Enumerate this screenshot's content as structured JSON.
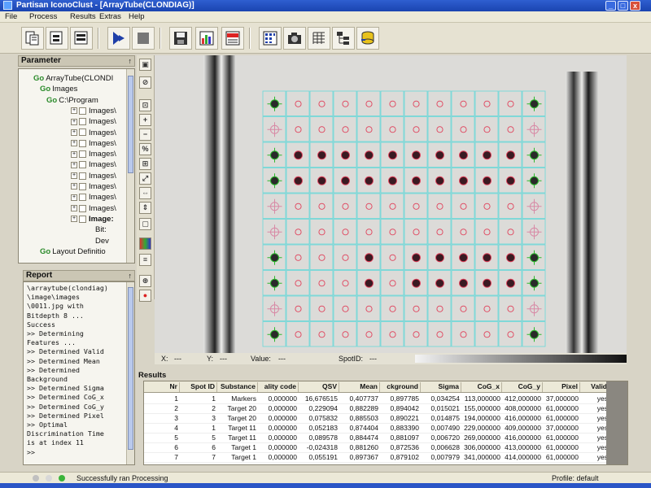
{
  "window": {
    "title": "Partisan IconoClust - [ArrayTube(CLONDIAG)]",
    "colors": {
      "title_bar": "#1a44b0",
      "chrome": "#d8d4c6",
      "grid": "#6ad8d8",
      "marker": "#2db82d",
      "spot": "#e0405a"
    }
  },
  "menu": [
    "File",
    "Process",
    "Results",
    "Extras",
    "Help"
  ],
  "toolbar": {
    "icons": [
      "open-icon",
      "import-icon",
      "export-icon",
      "run-icon",
      "stop-icon",
      "save-icon",
      "chart-icon",
      "pdf-icon",
      "grid-icon",
      "camera-icon",
      "matrix-icon",
      "tree-icon",
      "database-icon"
    ]
  },
  "parameter_panel": {
    "title": "Parameter",
    "pin": "↑",
    "tree": [
      {
        "prefix": "Go",
        "label": "ArrayTube(CLONDI",
        "level": 0
      },
      {
        "prefix": "Go",
        "label": "Images",
        "level": 1
      },
      {
        "prefix": "Go",
        "label": "C:\\Program",
        "level": 2
      },
      {
        "label": "Images\\",
        "level": 3
      },
      {
        "label": "Images\\",
        "level": 3
      },
      {
        "label": "Images\\",
        "level": 3
      },
      {
        "label": "Images\\",
        "level": 3
      },
      {
        "label": "Images\\",
        "level": 3
      },
      {
        "label": "Images\\",
        "level": 3
      },
      {
        "label": "Images\\",
        "level": 3
      },
      {
        "label": "Images\\",
        "level": 3
      },
      {
        "label": "Images\\",
        "level": 3
      },
      {
        "label": "Images\\",
        "level": 3
      },
      {
        "label": "Image:",
        "level": 3
      },
      {
        "label": "Bit:",
        "level": 4
      },
      {
        "label": "Dev",
        "level": 4
      },
      {
        "prefix": "Go",
        "label": "Layout Definitio",
        "level": 1
      }
    ]
  },
  "report_panel": {
    "title": "Report",
    "pin": "↑",
    "lines": [
      "\\arraytube(clondiag)",
      "\\image\\images",
      "\\0011.jpg with",
      "Bitdepth 8 ...",
      "Success",
      ">> Determining",
      "Features ...",
      ">> Determined Valid",
      ">> Determined Mean",
      ">> Determined",
      "Background",
      ">> Determined Sigma",
      ">> Determined CoG_x",
      ">> Determined CoG_y",
      ">> Determined Pixel",
      ">> Optimal",
      "Discrimination Time",
      "is at index 11",
      ">>"
    ]
  },
  "vertical_tools": [
    "select-icon",
    "erase-icon",
    "fit-icon",
    "zoom-in-icon",
    "zoom-out-icon",
    "percent-icon",
    "crop-icon",
    "expand-icon",
    "move-icon",
    "stretch-icon",
    "frame-icon",
    "palette-icon",
    "level-icon",
    "target-icon",
    "spot-icon"
  ],
  "coords": {
    "x_label": "X:",
    "x_value": "---",
    "y_label": "Y:",
    "y_value": "---",
    "value_label": "Value:",
    "value_value": "---",
    "spot_label": "SpotID:",
    "spot_value": "---"
  },
  "array_layout": {
    "rows": 10,
    "cols": 12
  },
  "results": {
    "title": "Results",
    "columns": [
      "Nr",
      "Spot ID",
      "Substance",
      "ality code",
      "QSV",
      "Mean",
      "ckground",
      "Sigma",
      "CoG_x",
      "CoG_y",
      "Pixel",
      "Valid"
    ],
    "rows": [
      [
        "1",
        "1",
        "Markers",
        "0,000000",
        "16,676515",
        "0,407737",
        "0,897785",
        "0,034254",
        "113,000000",
        "412,000000",
        "37,000000",
        "yes"
      ],
      [
        "2",
        "2",
        "Target 20",
        "0,000000",
        "0,229094",
        "0,882289",
        "0,894042",
        "0,015021",
        "155,000000",
        "408,000000",
        "61,000000",
        "yes"
      ],
      [
        "3",
        "3",
        "Target 20",
        "0,000000",
        "0,075832",
        "0,885503",
        "0,890221",
        "0,014875",
        "194,000000",
        "416,000000",
        "61,000000",
        "yes"
      ],
      [
        "4",
        "1",
        "Target 11",
        "0,000000",
        "0,052183",
        "0,874404",
        "0,883390",
        "0,007490",
        "229,000000",
        "409,000000",
        "37,000000",
        "yes"
      ],
      [
        "5",
        "5",
        "Target 11",
        "0,000000",
        "0,089578",
        "0,884474",
        "0,881097",
        "0,006720",
        "269,000000",
        "416,000000",
        "61,000000",
        "yes"
      ],
      [
        "6",
        "6",
        "Target 1",
        "0,000000",
        "-0,024318",
        "0,881260",
        "0,872536",
        "0,006628",
        "306,000000",
        "413,000000",
        "61,000000",
        "yes"
      ],
      [
        "7",
        "7",
        "Target 1",
        "0,000000",
        "0,055191",
        "0,897367",
        "0,879102",
        "0,007979",
        "341,000000",
        "414,000000",
        "61,000000",
        "yes"
      ]
    ]
  },
  "status": {
    "message": "Successfully ran Processing",
    "profile": "Profile: default"
  }
}
